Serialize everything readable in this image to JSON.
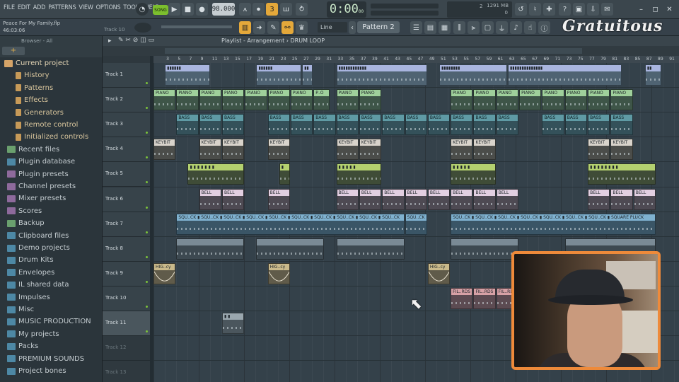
{
  "menu": [
    "FILE",
    "EDIT",
    "ADD",
    "PATTERNS",
    "VIEW",
    "OPTIONS",
    "TOOLS",
    "HELP"
  ],
  "transport": {
    "mode_label": "SONG",
    "tempo": "98.000",
    "time": "0:00",
    "time_sub": "00",
    "cpu_num": "2",
    "cpu_zero": "0",
    "memory": "1291 MB"
  },
  "project": {
    "name": "Peace For My Family.flp",
    "time": "46:03:06",
    "track_hint": "Track 10"
  },
  "snap": "Line",
  "pattern": "Pattern 2",
  "logo_text": "Gratuitous",
  "browser": {
    "title": "Browser - All",
    "plus": "+",
    "items": [
      {
        "label": "Current project",
        "kind": "root"
      },
      {
        "label": "History",
        "kind": "sub"
      },
      {
        "label": "Patterns",
        "kind": "sub"
      },
      {
        "label": "Effects",
        "kind": "sub"
      },
      {
        "label": "Generators",
        "kind": "sub"
      },
      {
        "label": "Remote control",
        "kind": "sub"
      },
      {
        "label": "Initialized controls",
        "kind": "sub"
      },
      {
        "label": "Recent files",
        "kind": "folder-g"
      },
      {
        "label": "Plugin database",
        "kind": "folder"
      },
      {
        "label": "Plugin presets",
        "kind": "folder-p"
      },
      {
        "label": "Channel presets",
        "kind": "folder-p"
      },
      {
        "label": "Mixer presets",
        "kind": "folder-p"
      },
      {
        "label": "Scores",
        "kind": "folder-p"
      },
      {
        "label": "Backup",
        "kind": "folder-g"
      },
      {
        "label": "Clipboard files",
        "kind": "folder"
      },
      {
        "label": "Demo projects",
        "kind": "folder"
      },
      {
        "label": "Drum Kits",
        "kind": "folder"
      },
      {
        "label": "Envelopes",
        "kind": "folder"
      },
      {
        "label": "IL shared data",
        "kind": "folder"
      },
      {
        "label": "Impulses",
        "kind": "folder"
      },
      {
        "label": "Misc",
        "kind": "folder"
      },
      {
        "label": "MUSIC PRODUCTION",
        "kind": "folder"
      },
      {
        "label": "My projects",
        "kind": "folder"
      },
      {
        "label": "Packs",
        "kind": "folder"
      },
      {
        "label": "PREMIUM SOUNDS",
        "kind": "folder"
      },
      {
        "label": "Project bones",
        "kind": "folder"
      }
    ]
  },
  "playlist": {
    "title": "Playlist - Arrangement",
    "crumb": "DRUM LOOP",
    "ruler": [
      "3",
      "5",
      "7",
      "9",
      "11",
      "13",
      "15",
      "17",
      "19",
      "21",
      "23",
      "25",
      "27",
      "29",
      "31",
      "33",
      "35",
      "37",
      "39",
      "41",
      "43",
      "45",
      "47",
      "49",
      "51",
      "53",
      "55",
      "57",
      "59",
      "61",
      "63",
      "65",
      "67",
      "69",
      "71",
      "73",
      "75",
      "77",
      "79",
      "81",
      "83",
      "85",
      "87",
      "89",
      "91"
    ],
    "tracks": [
      "Track 1",
      "Track 2",
      "Track 3",
      "Track 4",
      "Track 5",
      "Track 6",
      "Track 7",
      "Track 8",
      "Track 9",
      "Track 10",
      "Track 11",
      "Track 12",
      "Track 13"
    ],
    "clips": [
      {
        "row": 0,
        "bar": 3,
        "len": 8,
        "type": "drum",
        "label": "▮▮▮▮▮▮"
      },
      {
        "row": 0,
        "bar": 19,
        "len": 8,
        "type": "drum",
        "label": "▮▮▮▮▮▮"
      },
      {
        "row": 0,
        "bar": 27,
        "len": 2,
        "type": "drum",
        "label": "▮▮"
      },
      {
        "row": 0,
        "bar": 33,
        "len": 16,
        "type": "drum",
        "label": "▮▮▮▮▮▮▮▮▮▮▮▮"
      },
      {
        "row": 0,
        "bar": 51,
        "len": 12,
        "type": "drum",
        "label": "▮▮▮▮▮▮▮▮"
      },
      {
        "row": 0,
        "bar": 63,
        "len": 20,
        "type": "drum",
        "label": "▮▮▮▮▮▮▮▮▮▮▮▮▮▮"
      },
      {
        "row": 0,
        "bar": 87,
        "len": 3,
        "type": "drum",
        "label": "▮▮"
      },
      {
        "row": 1,
        "bar": 1,
        "len": 4,
        "type": "piano",
        "label": "PIANO"
      },
      {
        "row": 1,
        "bar": 5,
        "len": 4,
        "type": "piano",
        "label": "PIANO"
      },
      {
        "row": 1,
        "bar": 9,
        "len": 4,
        "type": "piano",
        "label": "PIANO"
      },
      {
        "row": 1,
        "bar": 13,
        "len": 4,
        "type": "piano",
        "label": "PIANO"
      },
      {
        "row": 1,
        "bar": 17,
        "len": 4,
        "type": "piano",
        "label": "PIANO"
      },
      {
        "row": 1,
        "bar": 21,
        "len": 4,
        "type": "piano",
        "label": "PIANO"
      },
      {
        "row": 1,
        "bar": 25,
        "len": 4,
        "type": "piano",
        "label": "PIANO"
      },
      {
        "row": 1,
        "bar": 29,
        "len": 3,
        "type": "piano",
        "label": "P..O"
      },
      {
        "row": 1,
        "bar": 33,
        "len": 4,
        "type": "piano",
        "label": "PIANO"
      },
      {
        "row": 1,
        "bar": 37,
        "len": 4,
        "type": "piano",
        "label": "PIANO"
      },
      {
        "row": 1,
        "bar": 53,
        "len": 4,
        "type": "piano",
        "label": "PIANO"
      },
      {
        "row": 1,
        "bar": 57,
        "len": 4,
        "type": "piano",
        "label": "PIANO"
      },
      {
        "row": 1,
        "bar": 61,
        "len": 4,
        "type": "piano",
        "label": "PIANO"
      },
      {
        "row": 1,
        "bar": 65,
        "len": 4,
        "type": "piano",
        "label": "PIANO"
      },
      {
        "row": 1,
        "bar": 69,
        "len": 4,
        "type": "piano",
        "label": "PIANO"
      },
      {
        "row": 1,
        "bar": 73,
        "len": 4,
        "type": "piano",
        "label": "PIANO"
      },
      {
        "row": 1,
        "bar": 77,
        "len": 4,
        "type": "piano",
        "label": "PIANO"
      },
      {
        "row": 1,
        "bar": 81,
        "len": 4,
        "type": "piano",
        "label": "PIANO"
      },
      {
        "row": 2,
        "bar": 5,
        "len": 4,
        "type": "bass",
        "label": "BASS"
      },
      {
        "row": 2,
        "bar": 9,
        "len": 4,
        "type": "bass",
        "label": "BASS"
      },
      {
        "row": 2,
        "bar": 13,
        "len": 4,
        "type": "bass",
        "label": "BASS"
      },
      {
        "row": 2,
        "bar": 21,
        "len": 4,
        "type": "bass",
        "label": "BASS"
      },
      {
        "row": 2,
        "bar": 25,
        "len": 4,
        "type": "bass",
        "label": "BASS"
      },
      {
        "row": 2,
        "bar": 29,
        "len": 4,
        "type": "bass",
        "label": "BASS"
      },
      {
        "row": 2,
        "bar": 33,
        "len": 4,
        "type": "bass",
        "label": "BASS"
      },
      {
        "row": 2,
        "bar": 37,
        "len": 4,
        "type": "bass",
        "label": "BASS"
      },
      {
        "row": 2,
        "bar": 41,
        "len": 4,
        "type": "bass",
        "label": "BASS"
      },
      {
        "row": 2,
        "bar": 45,
        "len": 4,
        "type": "bass",
        "label": "BASS"
      },
      {
        "row": 2,
        "bar": 49,
        "len": 4,
        "type": "bass",
        "label": "BASS"
      },
      {
        "row": 2,
        "bar": 53,
        "len": 4,
        "type": "bass",
        "label": "BASS"
      },
      {
        "row": 2,
        "bar": 57,
        "len": 4,
        "type": "bass",
        "label": "BASS"
      },
      {
        "row": 2,
        "bar": 61,
        "len": 4,
        "type": "bass",
        "label": "BASS"
      },
      {
        "row": 2,
        "bar": 69,
        "len": 4,
        "type": "bass",
        "label": "BASS"
      },
      {
        "row": 2,
        "bar": 73,
        "len": 4,
        "type": "bass",
        "label": "BASS"
      },
      {
        "row": 2,
        "bar": 77,
        "len": 4,
        "type": "bass",
        "label": "BASS"
      },
      {
        "row": 2,
        "bar": 81,
        "len": 4,
        "type": "bass",
        "label": "BASS"
      },
      {
        "row": 3,
        "bar": 1,
        "len": 4,
        "type": "key",
        "label": "KEYBIT"
      },
      {
        "row": 3,
        "bar": 9,
        "len": 4,
        "type": "key",
        "label": "KEYBIT"
      },
      {
        "row": 3,
        "bar": 13,
        "len": 4,
        "type": "key",
        "label": "KEYBIT"
      },
      {
        "row": 3,
        "bar": 21,
        "len": 4,
        "type": "key",
        "label": "KEYBIT"
      },
      {
        "row": 3,
        "bar": 33,
        "len": 4,
        "type": "key",
        "label": "KEYBIT"
      },
      {
        "row": 3,
        "bar": 37,
        "len": 4,
        "type": "key",
        "label": "KEYBIT"
      },
      {
        "row": 3,
        "bar": 53,
        "len": 4,
        "type": "key",
        "label": "KEYBIT"
      },
      {
        "row": 3,
        "bar": 57,
        "len": 4,
        "type": "key",
        "label": "KEYBIT"
      },
      {
        "row": 3,
        "bar": 77,
        "len": 4,
        "type": "key",
        "label": "KEYBIT"
      },
      {
        "row": 3,
        "bar": 81,
        "len": 4,
        "type": "key",
        "label": "KEYBIT"
      },
      {
        "row": 4,
        "bar": 7,
        "len": 10,
        "type": "t5",
        "label": "▮ ▮ ▮ ▮ ▮ ▮ ▮"
      },
      {
        "row": 4,
        "bar": 23,
        "len": 2,
        "type": "t5",
        "label": "▮"
      },
      {
        "row": 4,
        "bar": 33,
        "len": 8,
        "type": "t5",
        "label": "▮ ▮ ▮ ▮ ▮"
      },
      {
        "row": 4,
        "bar": 53,
        "len": 8,
        "type": "t5",
        "label": "▮ ▮ ▮ ▮ ▮"
      },
      {
        "row": 4,
        "bar": 77,
        "len": 12,
        "type": "t5",
        "label": "▮ ▮ ▮ ▮ ▮ ▮ ▮ ▮"
      },
      {
        "row": 5,
        "bar": 9,
        "len": 4,
        "type": "bell",
        "label": "BELL"
      },
      {
        "row": 5,
        "bar": 13,
        "len": 4,
        "type": "bell",
        "label": "BELL"
      },
      {
        "row": 5,
        "bar": 21,
        "len": 4,
        "type": "bell",
        "label": "BELL"
      },
      {
        "row": 5,
        "bar": 33,
        "len": 4,
        "type": "bell",
        "label": "BELL"
      },
      {
        "row": 5,
        "bar": 37,
        "len": 4,
        "type": "bell",
        "label": "BELL"
      },
      {
        "row": 5,
        "bar": 41,
        "len": 4,
        "type": "bell",
        "label": "BELL"
      },
      {
        "row": 5,
        "bar": 45,
        "len": 4,
        "type": "bell",
        "label": "BELL"
      },
      {
        "row": 5,
        "bar": 49,
        "len": 4,
        "type": "bell",
        "label": "BELL"
      },
      {
        "row": 5,
        "bar": 53,
        "len": 4,
        "type": "bell",
        "label": "BELL"
      },
      {
        "row": 5,
        "bar": 57,
        "len": 4,
        "type": "bell",
        "label": "BELL"
      },
      {
        "row": 5,
        "bar": 61,
        "len": 4,
        "type": "bell",
        "label": "BELL"
      },
      {
        "row": 5,
        "bar": 77,
        "len": 4,
        "type": "bell",
        "label": "BELL"
      },
      {
        "row": 5,
        "bar": 81,
        "len": 4,
        "type": "bell",
        "label": "BELL"
      },
      {
        "row": 5,
        "bar": 85,
        "len": 4,
        "type": "bell",
        "label": "BELL"
      },
      {
        "row": 6,
        "bar": 5,
        "len": 40,
        "type": "squ",
        "label": "SQU..CK ▮ SQU..CK ▮ SQU..CK ▮ SQU..CK ▮ SQU..CK ▮ SQU..CK ▮ SQU..CK ▮ SQU..CK ▮ SQU..CK ▮ SQU..CK"
      },
      {
        "row": 6,
        "bar": 45,
        "len": 4,
        "type": "squ",
        "label": "SQU..CK"
      },
      {
        "row": 6,
        "bar": 53,
        "len": 36,
        "type": "squ",
        "label": "SQU..CK ▮ SQU..CK ▮ SQU..CK ▮ SQU..CK ▮ SQU..CK ▮ SQU..CK ▮ SQU..CK ▮ SQUARE PLUCK"
      },
      {
        "row": 7,
        "bar": 5,
        "len": 12,
        "type": "t8",
        "label": ""
      },
      {
        "row": 7,
        "bar": 19,
        "len": 12,
        "type": "t8",
        "label": ""
      },
      {
        "row": 7,
        "bar": 33,
        "len": 12,
        "type": "t8",
        "label": ""
      },
      {
        "row": 7,
        "bar": 53,
        "len": 12,
        "type": "t8",
        "label": ""
      },
      {
        "row": 7,
        "bar": 73,
        "len": 16,
        "type": "t8",
        "label": ""
      },
      {
        "row": 8,
        "bar": 1,
        "len": 4,
        "type": "hig",
        "label": "HIG..cy"
      },
      {
        "row": 8,
        "bar": 21,
        "len": 4,
        "type": "hig",
        "label": "HIG..cy"
      },
      {
        "row": 8,
        "bar": 49,
        "len": 4,
        "type": "hig",
        "label": "HIG..cy"
      },
      {
        "row": 9,
        "bar": 53,
        "len": 4,
        "type": "fil",
        "label": "FIL..RDS"
      },
      {
        "row": 9,
        "bar": 57,
        "len": 4,
        "type": "fil",
        "label": "FIL..RDS"
      },
      {
        "row": 9,
        "bar": 61,
        "len": 3,
        "type": "fil",
        "label": "FIL..RD"
      },
      {
        "row": 10,
        "bar": 13,
        "len": 4,
        "type": "t11",
        "label": "▮ ▮"
      }
    ]
  }
}
